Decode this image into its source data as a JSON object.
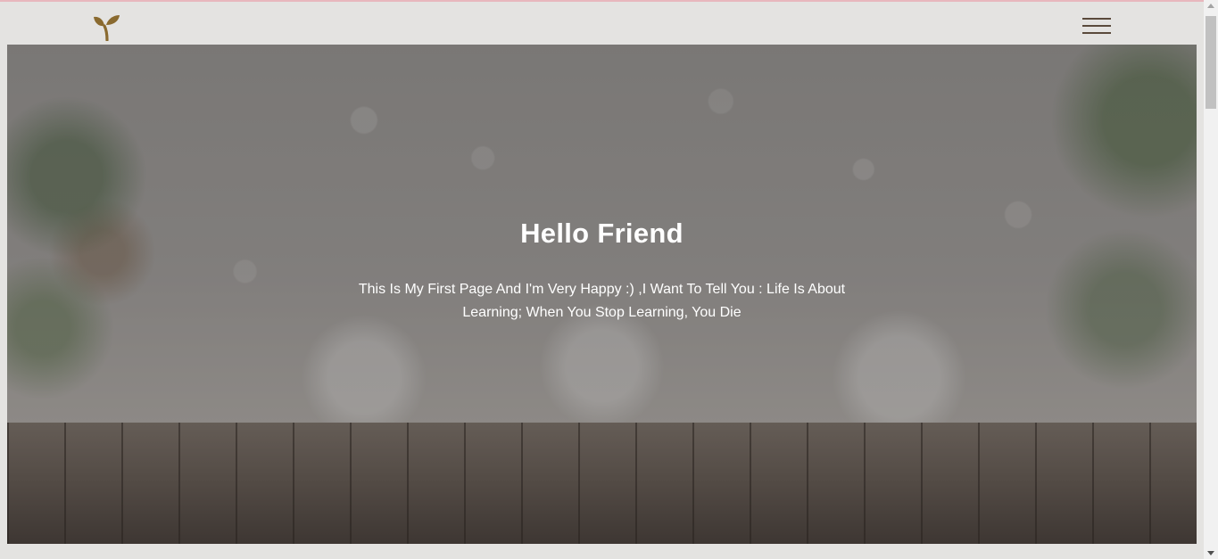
{
  "header": {
    "logo_icon": "sprout-icon",
    "menu_icon": "hamburger-menu-icon"
  },
  "hero": {
    "title": "Hello Friend",
    "text": "This Is My First Page And I'm Very Happy :) ,I Want To Tell You : Life Is About Learning; When You Stop Learning, You Die"
  },
  "colors": {
    "accent": "#8a6a2f",
    "header_bg": "#e4e3e1",
    "menu_lines": "#5a4a3c",
    "hero_text": "#ffffff"
  }
}
